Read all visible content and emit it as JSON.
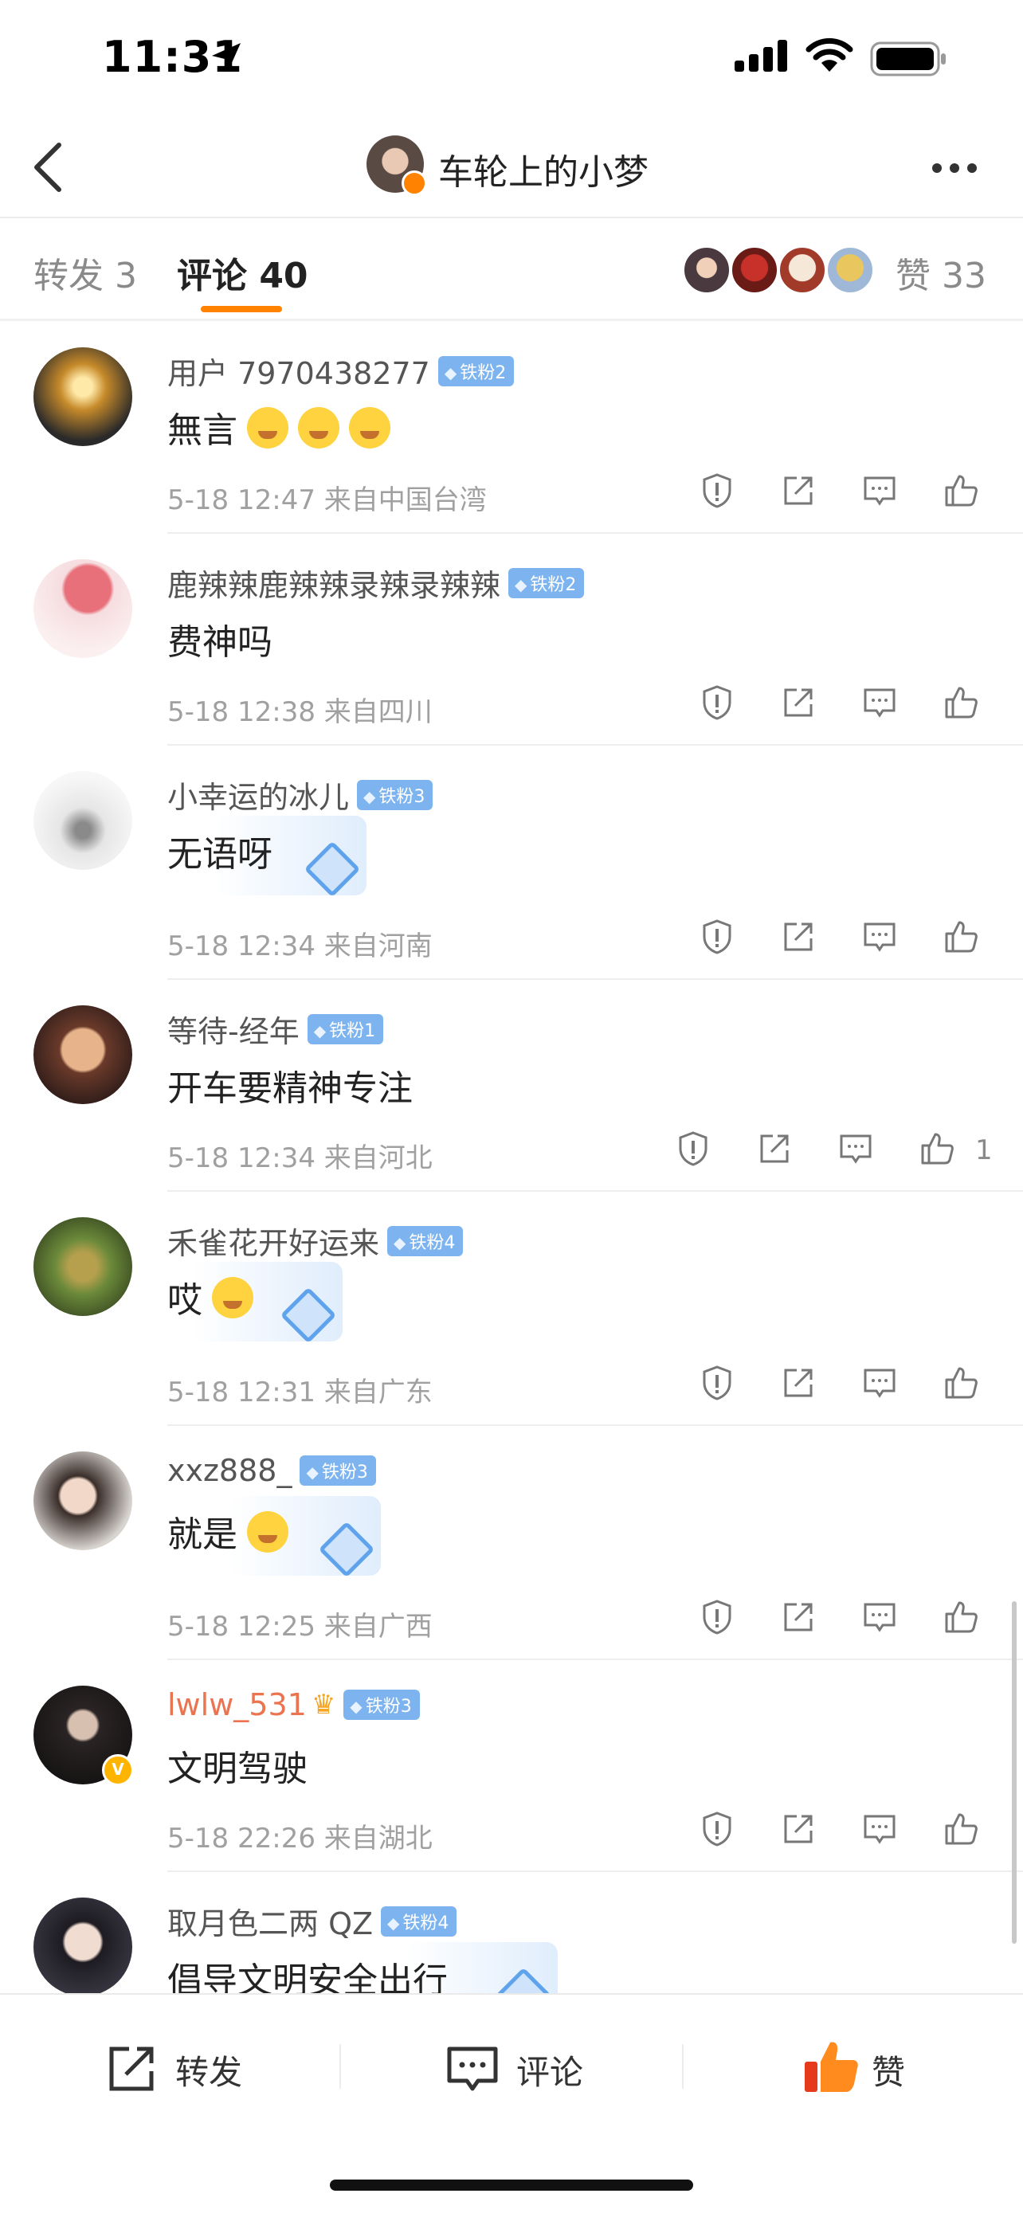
{
  "status_bar": {
    "time": "11:31"
  },
  "nav": {
    "title": "车轮上的小梦"
  },
  "tabs": {
    "repost": "转发 3",
    "comment": "评论 40",
    "likes": "赞 33"
  },
  "comments": [
    {
      "name": "用户 7970438277",
      "badge": "铁粉2",
      "text": "無言",
      "emoji_count": 3,
      "meta": "5-18 12:47  来自中国台湾",
      "likes": ""
    },
    {
      "name": "鹿辣辣鹿辣辣录辣录辣辣",
      "badge": "铁粉2",
      "text": "费神吗",
      "meta": "5-18 12:38  来自四川",
      "likes": ""
    },
    {
      "name": "小幸运的冰儿",
      "badge": "铁粉3",
      "text": "无语呀",
      "meta": "5-18 12:34  来自河南",
      "likes": ""
    },
    {
      "name": "等待-经年",
      "badge": "铁粉1",
      "text": "开车要精神专注",
      "meta": "5-18 12:34  来自河北",
      "likes": "1"
    },
    {
      "name": "禾雀花开好运来",
      "badge": "铁粉4",
      "text": "哎",
      "meta": "5-18 12:31  来自广东",
      "likes": ""
    },
    {
      "name": "xxz888_",
      "badge": "铁粉3",
      "text": "就是",
      "meta": "5-18 12:25  来自广西",
      "likes": ""
    },
    {
      "name": "lwlw_531",
      "badge": "铁粉3",
      "text": "文明驾驶",
      "meta": "5-18 22:26  来自湖北",
      "likes": ""
    },
    {
      "name": "取月色二两 QZ",
      "badge": "铁粉4",
      "text": "倡导文明安全出行",
      "meta": "",
      "likes": ""
    }
  ],
  "bottom_bar": {
    "repost": "转发",
    "comment": "评论",
    "like": "赞"
  },
  "colors": {
    "accent": "#ff8200",
    "badge": "#7db4ef",
    "vip_name": "#eb7350",
    "meta_text": "#a0a0a0"
  }
}
